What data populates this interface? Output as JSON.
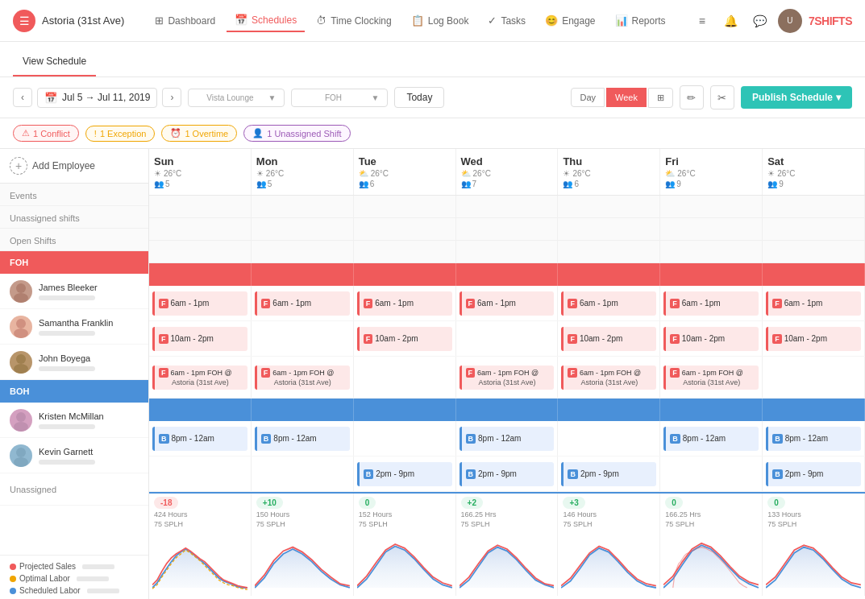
{
  "app": {
    "title": "7SHIFTS",
    "location": "Astoria (31st Ave)"
  },
  "nav": {
    "links": [
      {
        "label": "Dashboard",
        "icon": "🏠",
        "active": false
      },
      {
        "label": "Schedules",
        "icon": "📅",
        "active": true
      },
      {
        "label": "Time Clocking",
        "icon": "⏱",
        "active": false
      },
      {
        "label": "Log Book",
        "icon": "📋",
        "active": false
      },
      {
        "label": "Tasks",
        "icon": "✓",
        "active": false
      },
      {
        "label": "Engage",
        "icon": "😊",
        "active": false
      },
      {
        "label": "Reports",
        "icon": "📊",
        "active": false
      }
    ]
  },
  "secondary_nav": {
    "links": [
      {
        "label": "View Schedule",
        "active": true
      },
      {
        "label": "",
        "active": false
      },
      {
        "label": "",
        "active": false
      },
      {
        "label": "",
        "active": false
      }
    ]
  },
  "toolbar": {
    "date_range": "Jul 5 → Jul 11, 2019",
    "location_select": "Vista Lounge",
    "role_select": "FOH",
    "today_label": "Today",
    "view_day": "Day",
    "view_week": "Week",
    "publish_label": "Publish Schedule"
  },
  "alerts": [
    {
      "label": "1 Conflict",
      "type": "conflict"
    },
    {
      "label": "1 Exception",
      "type": "exception"
    },
    {
      "label": "1 Overtime",
      "type": "overtime"
    },
    {
      "label": "1 Unassigned Shift",
      "type": "unassigned"
    }
  ],
  "sidebar": {
    "add_employee": "Add Employee",
    "sections": {
      "events": "Events",
      "unassigned_shifts": "Unassigned shifts",
      "open_shifts": "Open Shifts"
    },
    "roles": {
      "red": "FOH",
      "blue": "BOH"
    },
    "employees_foh": [
      {
        "name": "James Bleeker",
        "avatar_bg": "#c49a8a"
      },
      {
        "name": "Samantha Franklin",
        "avatar_bg": "#e8b4a0"
      },
      {
        "name": "John Boyega",
        "avatar_bg": "#b8956a"
      }
    ],
    "employees_boh": [
      {
        "name": "Kristen McMillan",
        "avatar_bg": "#d4a0c0"
      },
      {
        "name": "Kevin Garnett",
        "avatar_bg": "#90b8d0"
      }
    ],
    "unassigned": "Unassigned"
  },
  "days": [
    {
      "name": "Sun",
      "temp": "26°C",
      "staff": 5
    },
    {
      "name": "Mon",
      "temp": "26°C",
      "staff": 5
    },
    {
      "name": "Tue",
      "temp": "26°C",
      "staff": 6
    },
    {
      "name": "Wed",
      "temp": "26°C",
      "staff": 7
    },
    {
      "name": "Thu",
      "temp": "26°C",
      "staff": 6
    },
    {
      "name": "Fri",
      "temp": "26°C",
      "staff": 9
    },
    {
      "name": "Sat",
      "temp": "26°C",
      "staff": 9
    }
  ],
  "shifts": {
    "james": [
      "6am - 1pm",
      "6am - 1pm",
      "6am - 1pm",
      "6am - 1pm",
      "6am - 1pm",
      "6am - 1pm",
      "6am - 1pm"
    ],
    "samantha": [
      "10am - 2pm",
      "",
      "10am - 2pm",
      "",
      "10am - 2pm",
      "10am - 2pm",
      "10am - 2pm"
    ],
    "john": [
      "6am - 1pm FOH @ Astoria (31st Ave)",
      "6am - 1pm FOH @ Astoria (31st Ave)",
      "",
      "6am - 1pm FOH @ Astoria (31st Ave)",
      "6am - 1pm FOH @ Astoria (31st Ave)",
      "6am - 1pm FOH @ Astoria (31st Ave)",
      ""
    ],
    "kristen": [
      "8pm - 12am",
      "8pm - 12am",
      "",
      "8pm - 12am",
      "",
      "8pm - 12am",
      "8pm - 12am"
    ],
    "kevin": [
      "",
      "",
      "2pm - 9pm",
      "2pm - 9pm",
      "2pm - 9pm",
      "",
      "2pm - 9pm"
    ]
  },
  "stats": [
    {
      "badge": "-18",
      "type": "neg",
      "hours": "424 Hours",
      "splh": "75 SPLH"
    },
    {
      "badge": "+10",
      "type": "pos",
      "hours": "150 Hours",
      "splh": "75 SPLH"
    },
    {
      "badge": "0",
      "type": "zero",
      "hours": "152 Hours",
      "splh": "75 SPLH"
    },
    {
      "badge": "+2",
      "type": "pos",
      "hours": "166.25 Hrs",
      "splh": "75 SPLH"
    },
    {
      "badge": "+3",
      "type": "pos",
      "hours": "146 Hours",
      "splh": "75 SPLH"
    },
    {
      "badge": "0",
      "type": "zero",
      "hours": "166.25 Hrs",
      "splh": "75 SPLH"
    },
    {
      "badge": "0",
      "type": "zero",
      "hours": "133 Hours",
      "splh": "75 SPLH"
    }
  ],
  "legend": {
    "projected_sales": "Projected Sales",
    "optimal_labor": "Optimal Labor",
    "scheduled_labor": "Scheduled Labor"
  },
  "colors": {
    "red": "#f05a5b",
    "blue": "#4a90d9",
    "teal": "#2ec4b6",
    "orange": "#f0a500",
    "purple": "#9b59b6"
  }
}
